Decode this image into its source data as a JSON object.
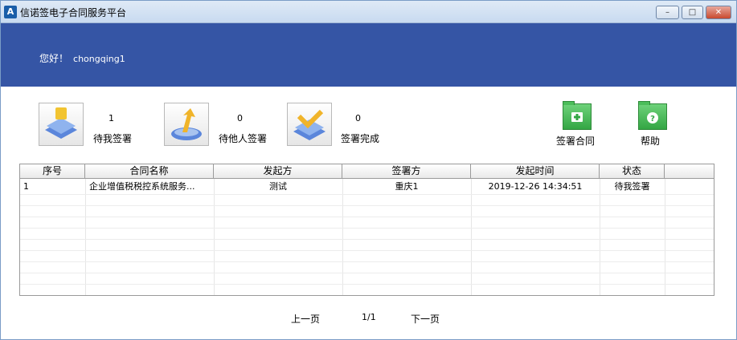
{
  "window": {
    "title": "信诺签电子合同服务平台",
    "icon_text": "A",
    "controls": {
      "minimize": "–",
      "maximize": "□",
      "close": "✕"
    }
  },
  "header": {
    "greeting": "您好！",
    "username": "chongqing1"
  },
  "stats": [
    {
      "icon": "pending-me-icon",
      "count": "1",
      "label": "待我签署"
    },
    {
      "icon": "pending-others-icon",
      "count": "0",
      "label": "待他人签署"
    },
    {
      "icon": "completed-icon",
      "count": "0",
      "label": "签署完成"
    }
  ],
  "actions": {
    "sign_contract": {
      "label": "签署合同",
      "icon": "add-folder-icon"
    },
    "help": {
      "label": "帮助",
      "icon": "help-folder-icon"
    }
  },
  "table": {
    "columns": [
      "序号",
      "合同名称",
      "发起方",
      "签署方",
      "发起时间",
      "状态"
    ],
    "rows": [
      {
        "no": "1",
        "name": "企业增值税税控系统服务...",
        "initiator": "测试",
        "signer": "重庆1",
        "time": "2019-12-26 14:34:51",
        "status": "待我签署"
      }
    ]
  },
  "pagination": {
    "prev": "上一页",
    "page": "1/1",
    "next": "下一页"
  },
  "colors": {
    "banner": "#3555a5",
    "action_green": "#33a644"
  }
}
